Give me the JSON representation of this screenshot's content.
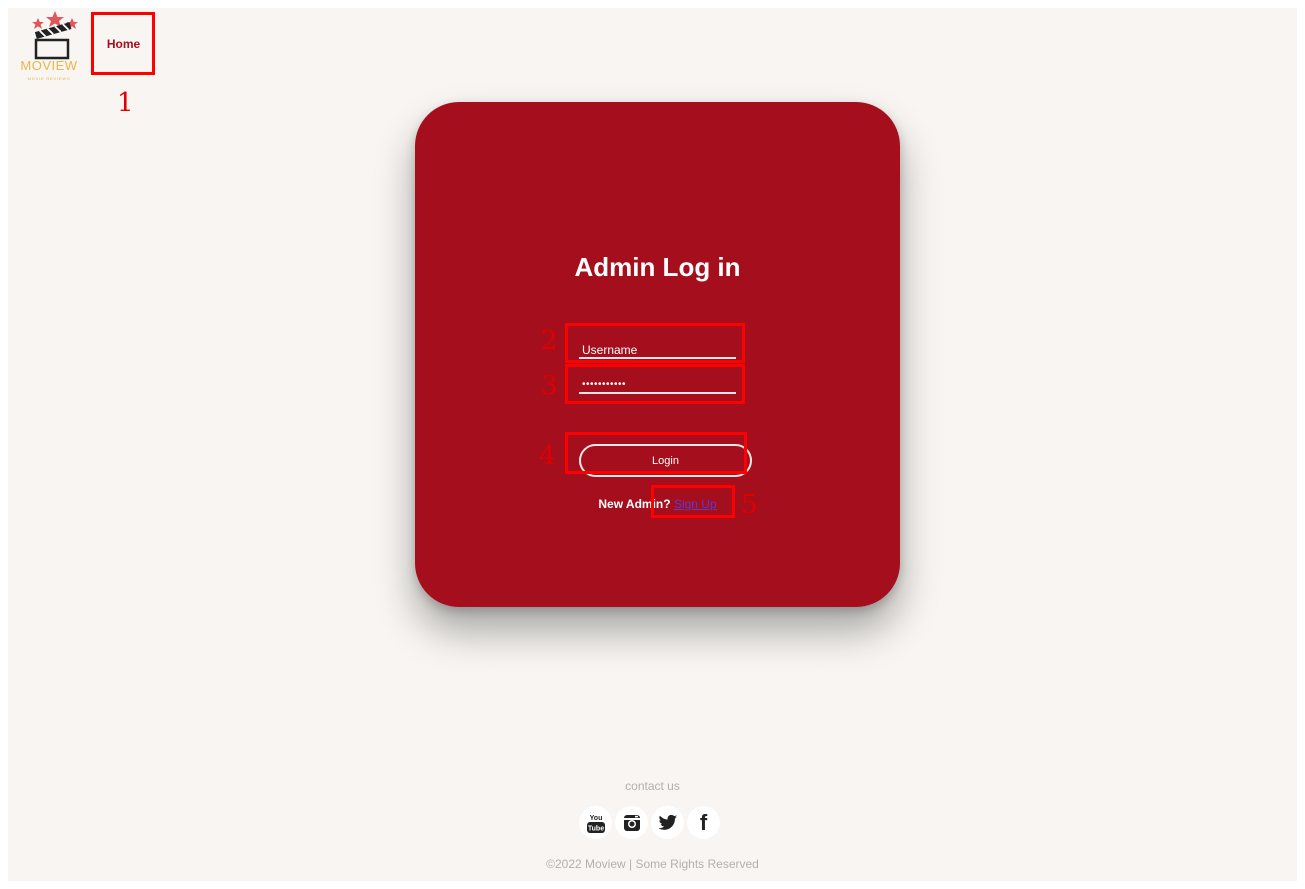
{
  "header": {
    "logo_text": "MOVIEW",
    "logo_subtext": "MOVIE REVIEWS",
    "home_label": "Home"
  },
  "login_card": {
    "title": "Admin Log in",
    "username_value": "Username",
    "password_value": "•••••••••••",
    "login_label": "Login",
    "new_admin_text": "New Admin?",
    "signup_label": "Sign Up"
  },
  "footer": {
    "contact_label": "contact us",
    "social_icons": [
      "youtube-icon",
      "instagram-icon",
      "twitter-icon",
      "facebook-icon"
    ],
    "youtube_text_top": "You",
    "youtube_text_bottom": "Tube",
    "facebook_glyph": "f",
    "copyright": "©2022 Moview | Some Rights Reserved"
  },
  "annotations": [
    "1",
    "2",
    "3",
    "4",
    "5"
  ],
  "colors": {
    "card_red": "#a50e1c",
    "page_bg": "#f8f5f2",
    "logo_gold": "#e8b64a",
    "annotation_red": "#ff0000",
    "link_purple": "#5a3bd0"
  }
}
